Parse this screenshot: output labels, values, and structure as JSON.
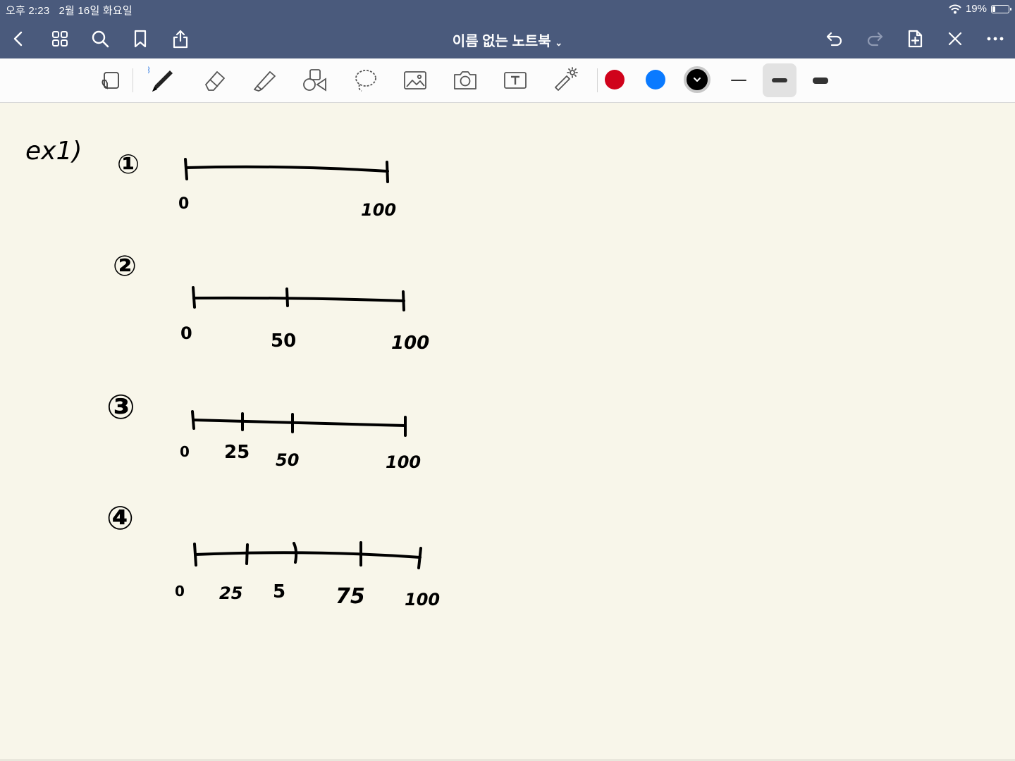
{
  "status": {
    "time": "오후 2:23",
    "date": "2월 16일 화요일",
    "battery": "19%",
    "battery_level": 0.19
  },
  "nav": {
    "title": "이름 없는 노트북"
  },
  "toolbar": {
    "colors": [
      "#d0021b",
      "#0a7aff",
      "#000000"
    ],
    "selected_color": "#000000"
  },
  "note": {
    "heading": "ex1)",
    "examples": [
      {
        "number": "①",
        "ticks": [
          "0",
          "100"
        ]
      },
      {
        "number": "②",
        "ticks": [
          "0",
          "50",
          "100"
        ]
      },
      {
        "number": "③",
        "ticks": [
          "0",
          "25",
          "50",
          "100"
        ]
      },
      {
        "number": "④",
        "ticks": [
          "0",
          "25",
          "5",
          "75",
          "100"
        ]
      }
    ]
  }
}
